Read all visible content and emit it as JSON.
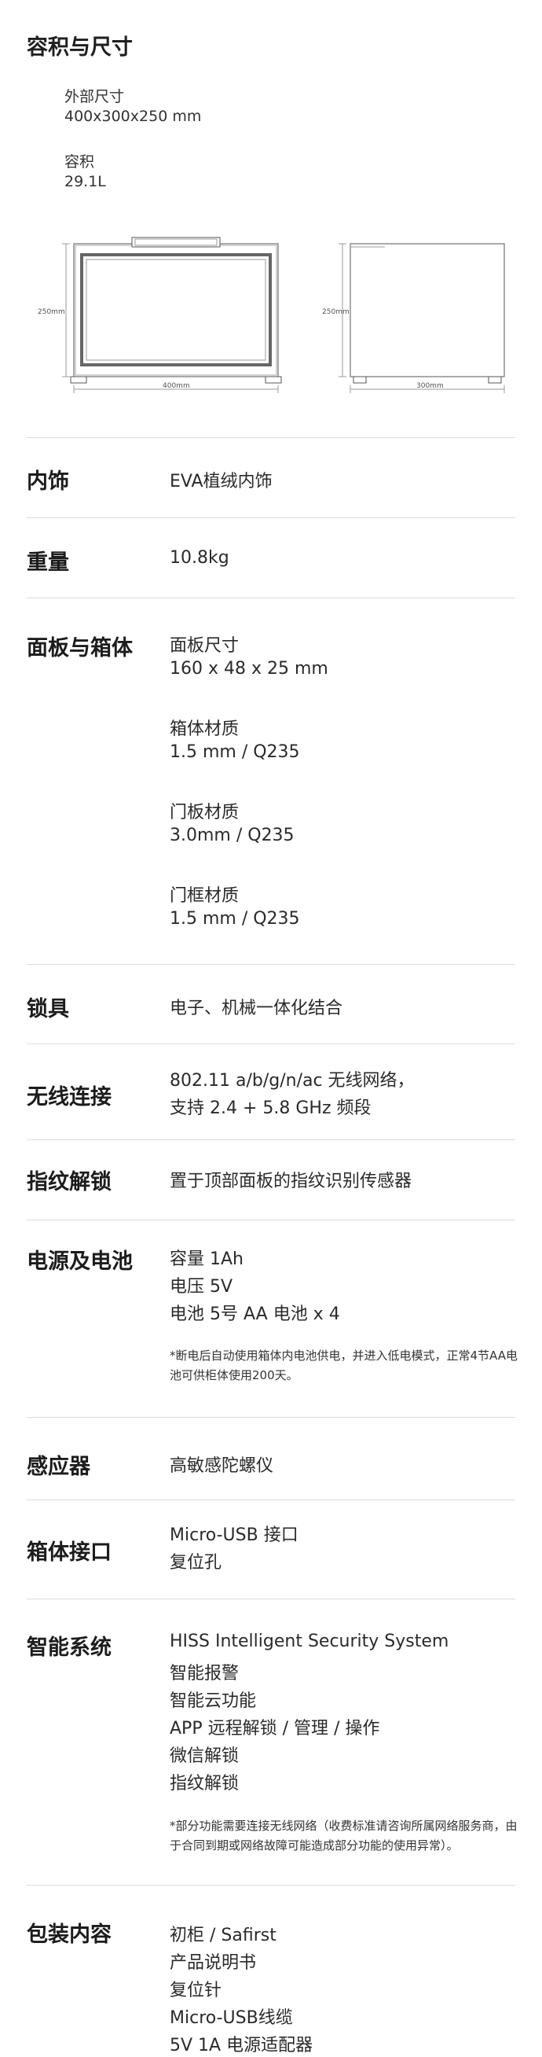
{
  "section_title": "容积与尺寸",
  "dimensions": {
    "outer_label": "外部尺寸",
    "outer_value": "400x300x250 mm",
    "volume_label": "容积",
    "volume_value": "29.1L",
    "diagram": {
      "front_height_label": "250mm",
      "front_width_label": "400mm",
      "side_height_label": "250mm",
      "side_width_label": "300mm"
    }
  },
  "specs": [
    {
      "label": "内饰",
      "lines": [
        "EVA植绒内饰"
      ]
    },
    {
      "label": "重量",
      "lines": [
        "10.8kg"
      ]
    },
    {
      "label": "面板与箱体",
      "lines": [
        "面板尺寸",
        "160 x 48 x 25 mm",
        "箱体材质",
        "1.5 mm / Q235",
        "门板材质",
        "3.0mm / Q235",
        "门框材质",
        "1.5 mm / Q235"
      ]
    },
    {
      "label": "锁具",
      "lines": [
        "电子、机械一体化结合"
      ]
    },
    {
      "label": "无线连接",
      "lines": [
        "802.11 a/b/g/n/ac 无线网络，",
        "支持 2.4 + 5.8 GHz 频段"
      ]
    },
    {
      "label": "指纹解锁",
      "lines": [
        "置于顶部面板的指纹识别传感器"
      ]
    },
    {
      "label": "电源及电池",
      "lines": [
        "容量  1Ah",
        "电压  5V",
        "电池  5号 AA 电池 x 4"
      ],
      "note": "*断电后自动使用箱体内电池供电，并进入低电模式，正常4节AA电池可供柜体使用200天。"
    },
    {
      "label": "感应器",
      "lines": [
        "高敏感陀螺仪"
      ]
    },
    {
      "label": "箱体接口",
      "lines": [
        "Micro-USB 接口",
        "复位孔"
      ]
    },
    {
      "label": "智能系统",
      "lines": [
        "HISS Intelligent Security System",
        "智能报警",
        "智能云功能",
        "APP 远程解锁 / 管理 / 操作",
        "微信解锁",
        "指纹解锁"
      ],
      "note": "*部分功能需要连接无线网络（收费标准请咨询所属网络服务商，由于合同到期或网络故障可能造成部分功能的使用异常）。"
    },
    {
      "label": "包装内容",
      "lines": [
        "初柜 / Safirst",
        "产品说明书",
        "复位针",
        "Micro-USB线缆",
        "5V 1A 电源适配器"
      ]
    }
  ]
}
